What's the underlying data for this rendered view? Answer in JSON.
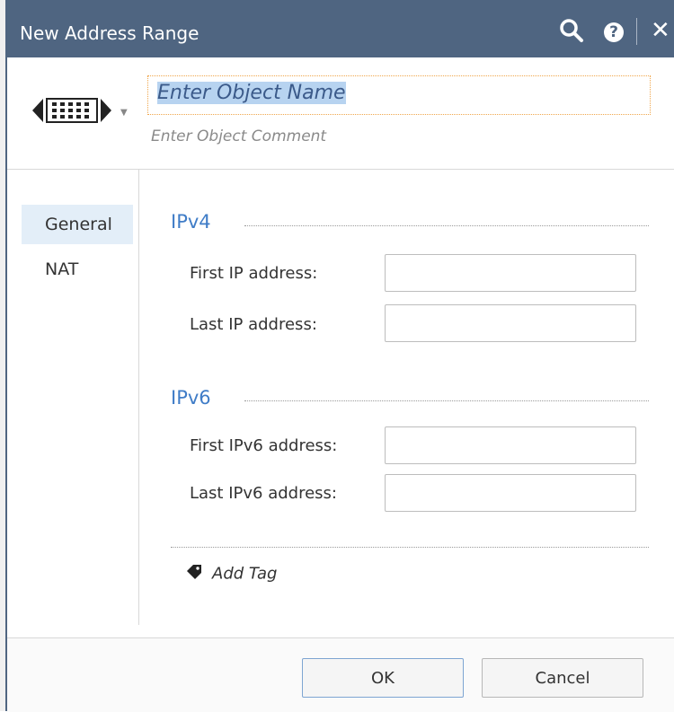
{
  "window": {
    "title": "New Address Range"
  },
  "header": {
    "name_placeholder": "Enter Object Name",
    "comment_placeholder": "Enter Object Comment"
  },
  "nav": {
    "items": [
      {
        "label": "General"
      },
      {
        "label": "NAT"
      }
    ]
  },
  "ipv4": {
    "title": "IPv4",
    "first_label": "First IP address:",
    "last_label": "Last IP address:"
  },
  "ipv6": {
    "title": "IPv6",
    "first_label": "First IPv6 address:",
    "last_label": "Last IPv6 address:"
  },
  "tag": {
    "label": "Add Tag"
  },
  "buttons": {
    "ok": "OK",
    "cancel": "Cancel"
  },
  "icons": [
    "search-icon",
    "help-icon",
    "close-icon",
    "address-range-icon",
    "chevron-down-icon",
    "tag-icon"
  ],
  "colors": {
    "titlebar": "#4f6581",
    "accent": "#3f7cc7",
    "nav_active": "#e3eef8"
  }
}
